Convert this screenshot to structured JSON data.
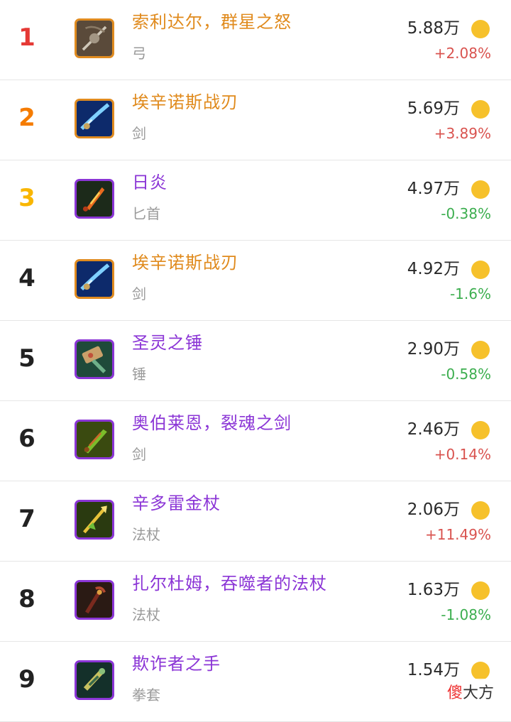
{
  "items": [
    {
      "rank": "1",
      "rank_color": "#e53935",
      "name": "索利达尔，群星之怒",
      "type": "弓",
      "price": "5.88万",
      "change": "+2.08%",
      "trend": "up",
      "quality": "legendary",
      "icon": "bow-icon",
      "icon_bg": "#5a4a3a"
    },
    {
      "rank": "2",
      "rank_color": "#f57c00",
      "name": "埃辛诺斯战刃",
      "type": "剑",
      "price": "5.69万",
      "change": "+3.89%",
      "trend": "up",
      "quality": "legendary",
      "icon": "glaive-icon",
      "icon_bg": "#0d2a6b"
    },
    {
      "rank": "3",
      "rank_color": "#f9b600",
      "name": "日炎",
      "type": "匕首",
      "price": "4.97万",
      "change": "-0.38%",
      "trend": "down",
      "quality": "epic",
      "icon": "dagger-icon",
      "icon_bg": "#1c2a1a"
    },
    {
      "rank": "4",
      "rank_color": "#222222",
      "name": "埃辛诺斯战刃",
      "type": "剑",
      "price": "4.92万",
      "change": "-1.6%",
      "trend": "down",
      "quality": "legendary",
      "icon": "glaive-icon",
      "icon_bg": "#0d2a6b"
    },
    {
      "rank": "5",
      "rank_color": "#222222",
      "name": "圣灵之锤",
      "type": "锤",
      "price": "2.90万",
      "change": "-0.58%",
      "trend": "down",
      "quality": "epic",
      "icon": "hammer-icon",
      "icon_bg": "#1f4a3a"
    },
    {
      "rank": "6",
      "rank_color": "#222222",
      "name": "奥伯莱恩，裂魂之剑",
      "type": "剑",
      "price": "2.46万",
      "change": "+0.14%",
      "trend": "up",
      "quality": "epic",
      "icon": "sword-icon",
      "icon_bg": "#3a4a10"
    },
    {
      "rank": "7",
      "rank_color": "#222222",
      "name": "辛多雷金杖",
      "type": "法杖",
      "price": "2.06万",
      "change": "+11.49%",
      "trend": "up",
      "quality": "epic",
      "icon": "staff-icon",
      "icon_bg": "#2a3a10"
    },
    {
      "rank": "8",
      "rank_color": "#222222",
      "name": "扎尔杜姆，吞噬者的法杖",
      "type": "法杖",
      "price": "1.63万",
      "change": "-1.08%",
      "trend": "down",
      "quality": "epic",
      "icon": "claw-staff-icon",
      "icon_bg": "#2a1a14"
    },
    {
      "rank": "9",
      "rank_color": "#222222",
      "name": "欺诈者之手",
      "type": "拳套",
      "price": "1.54万",
      "change": "",
      "trend": "down",
      "quality": "epic",
      "icon": "fist-icon",
      "icon_bg": "#14302a"
    }
  ],
  "coin_color": "#f6c12b",
  "watermark": {
    "first": "傻",
    "rest": "大方"
  }
}
